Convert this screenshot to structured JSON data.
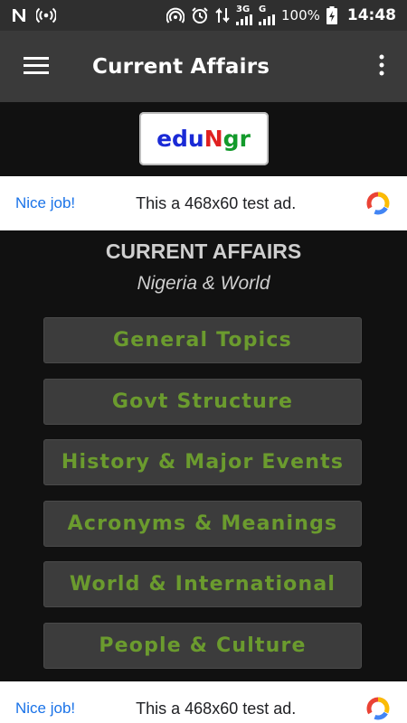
{
  "status_bar": {
    "time": "14:48",
    "battery": "100%",
    "network_3g": "3G",
    "network_g": "G",
    "icons": [
      "notification-n-icon",
      "broadcast-icon",
      "hotspot-icon",
      "alarm-icon",
      "data-transfer-icon",
      "signal-icon",
      "battery-charging-icon"
    ]
  },
  "app_bar": {
    "title": "Current Affairs"
  },
  "logo": {
    "part1": "edu",
    "part2": "N",
    "part3": "gr"
  },
  "ads": {
    "top": {
      "nice": "Nice job!",
      "text": "This a 468x60 test ad."
    },
    "bottom": {
      "nice": "Nice job!",
      "text": "This a 468x60 test ad."
    }
  },
  "main": {
    "heading": "CURRENT AFFAIRS",
    "subheading": "Nigeria & World",
    "menu": [
      "General Topics",
      "Govt Structure",
      "History & Major Events",
      "Acronyms & Meanings",
      "World & International",
      "People & Culture"
    ]
  },
  "colors": {
    "menu_text": "#6b9b2e",
    "menu_bg": "#3c3c3c",
    "app_bar": "#3a3a3a",
    "background": "#111111"
  }
}
